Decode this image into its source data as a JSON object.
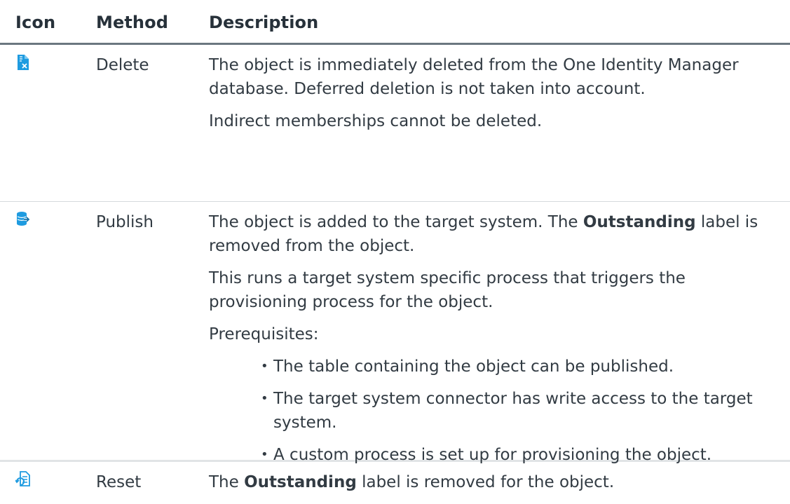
{
  "table": {
    "headers": {
      "icon": "Icon",
      "method": "Method",
      "description": "Description"
    },
    "rows": [
      {
        "icon": "delete-document-icon",
        "method": "Delete",
        "paragraphs": [
          "The object is immediately deleted from the One Identity Manager database. Deferred deletion is not taken into account.",
          "Indirect memberships cannot be deleted."
        ]
      },
      {
        "icon": "publish-database-icon",
        "method": "Publish",
        "p1_before": "The object is added to the target system. The ",
        "p1_bold": "Outstanding",
        "p1_after": " label is removed from the object.",
        "p2": "This runs a target system specific process that triggers the provisioning process for the object.",
        "p3": "Prerequisites:",
        "bullets": [
          "The table containing the object can be published.",
          "The target system connector has write access to the target system.",
          "A custom process is set up for provisioning the object."
        ]
      },
      {
        "icon": "reset-list-icon",
        "method": "Reset",
        "p1_before": "The ",
        "p1_bold": "Outstanding",
        "p1_after": " label is removed for the object."
      }
    ]
  },
  "colors": {
    "icon_blue": "#1e9be0",
    "text": "#323b43",
    "header_rule": "#6b7780"
  }
}
